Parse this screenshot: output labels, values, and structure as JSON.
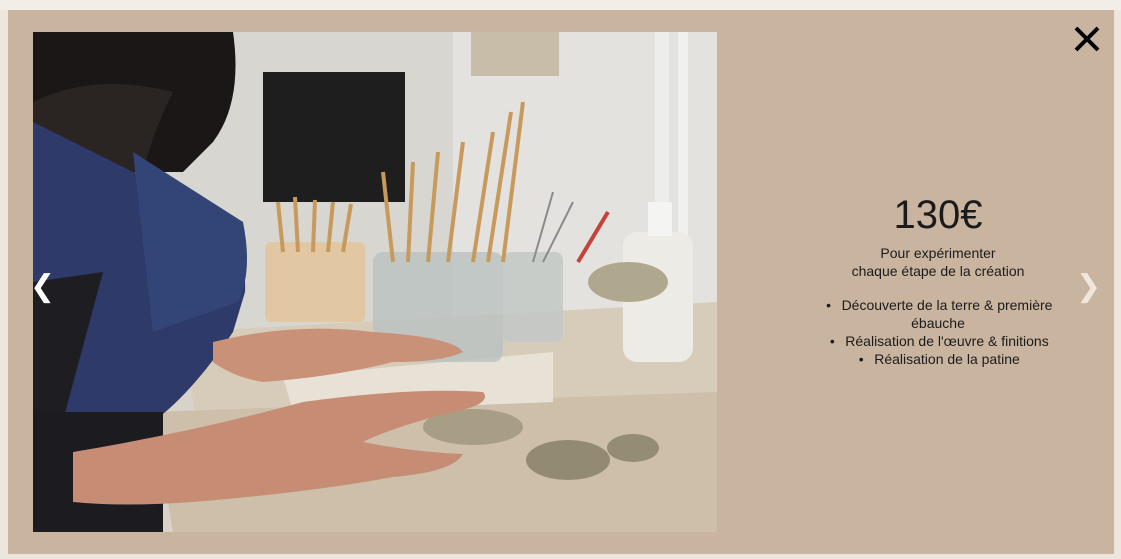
{
  "modal": {
    "price": "130€",
    "subtitle_line1": "Pour expérimenter",
    "subtitle_line2": "chaque étape de la création",
    "features": [
      "Découverte de la terre & première ébauche",
      "Réalisation de l'œuvre & finitions",
      "Réalisation de la patine"
    ],
    "prev_arrow": "❮",
    "next_arrow": "❯",
    "bullet": "•"
  },
  "colors": {
    "modal_background": "#c9b59f",
    "page_background": "#ece6dd",
    "close_icon": "#000000"
  }
}
